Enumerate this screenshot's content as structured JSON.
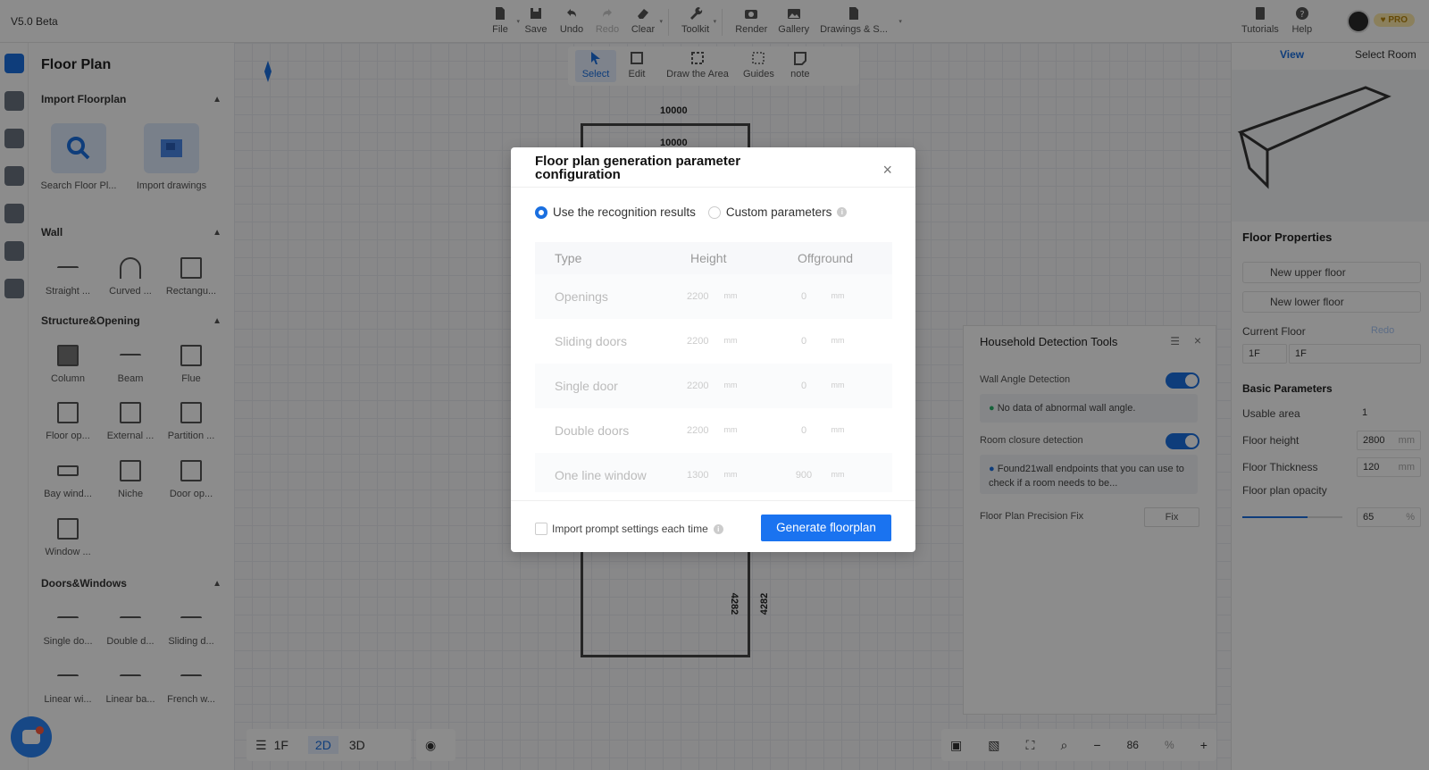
{
  "app": {
    "version": "V5.0 Beta",
    "pro_badge": "♥ PRO"
  },
  "toolbar": {
    "file": "File",
    "save": "Save",
    "undo": "Undo",
    "redo": "Redo",
    "clear": "Clear",
    "toolkit": "Toolkit",
    "render": "Render",
    "gallery": "Gallery",
    "drawings": "Drawings & S...",
    "tutorials": "Tutorials",
    "help": "Help"
  },
  "subtoolbar": {
    "select": "Select",
    "edit": "Edit",
    "draw_area": "Draw the Area",
    "guides": "Guides",
    "note": "note"
  },
  "left_panel": {
    "title": "Floor Plan",
    "import_section": "Import Floorplan",
    "search_floor": "Search Floor Pl...",
    "import_drawings": "Import drawings",
    "wall_section": "Wall",
    "walls": [
      "Straight ...",
      "Curved ...",
      "Rectangu..."
    ],
    "structure_section": "Structure&Opening",
    "structures": [
      "Column",
      "Beam",
      "Flue",
      "Floor op...",
      "External ...",
      "Partition ...",
      "Bay wind...",
      "Niche",
      "Door op...",
      "Window ..."
    ],
    "doors_section": "Doors&Windows",
    "doors": [
      "Single do...",
      "Double d...",
      "Sliding d...",
      "Linear wi...",
      "Linear ba...",
      "French w..."
    ]
  },
  "canvas": {
    "dim_top_1": "10000",
    "dim_top_2": "10000",
    "dim_side_1": "4282",
    "dim_side_2": "4282"
  },
  "bottom_bar": {
    "floor": "1F",
    "mode_2d": "2D",
    "mode_3d": "3D",
    "zoom": "86",
    "zoom_unit": "%"
  },
  "detection_panel": {
    "title": "Household Detection Tools",
    "wall_angle": "Wall Angle Detection",
    "wall_angle_msg": "No data of abnormal wall angle.",
    "room_closure": "Room closure detection",
    "room_closure_msg": "Found21wall endpoints that you can use to check if a room needs to be...",
    "precision_fix": "Floor Plan Precision Fix",
    "fix_btn": "Fix"
  },
  "right_panel": {
    "tab_view": "View",
    "tab_select_room": "Select Room",
    "floor_properties": "Floor Properties",
    "new_upper": "New upper floor",
    "new_lower": "New lower floor",
    "current_floor": "Current Floor",
    "redo": "Redo",
    "floor_select": "1F",
    "floor_name": "1F",
    "basic_params": "Basic Parameters",
    "usable_area": "Usable area",
    "usable_area_val": "1",
    "floor_height": "Floor height",
    "floor_height_val": "2800",
    "floor_thickness": "Floor Thickness",
    "floor_thickness_val": "120",
    "opacity": "Floor plan opacity",
    "opacity_val": "65",
    "unit_mm": "mm",
    "unit_pct": "%"
  },
  "modal": {
    "title": "Floor plan generation parameter configuration",
    "close": "×",
    "opt_recognition": "Use the recognition results",
    "opt_custom": "Custom parameters",
    "col_type": "Type",
    "col_height": "Height",
    "col_offground": "Offground",
    "unit": "mm",
    "rows": [
      {
        "type": "Openings",
        "height": "2200",
        "off": "0"
      },
      {
        "type": "Sliding doors",
        "height": "2200",
        "off": "0"
      },
      {
        "type": "Single door",
        "height": "2200",
        "off": "0"
      },
      {
        "type": "Double doors",
        "height": "2200",
        "off": "0"
      },
      {
        "type": "One line window",
        "height": "1300",
        "off": "900"
      }
    ],
    "import_prompt": "Import prompt settings each time",
    "generate": "Generate floorplan"
  }
}
